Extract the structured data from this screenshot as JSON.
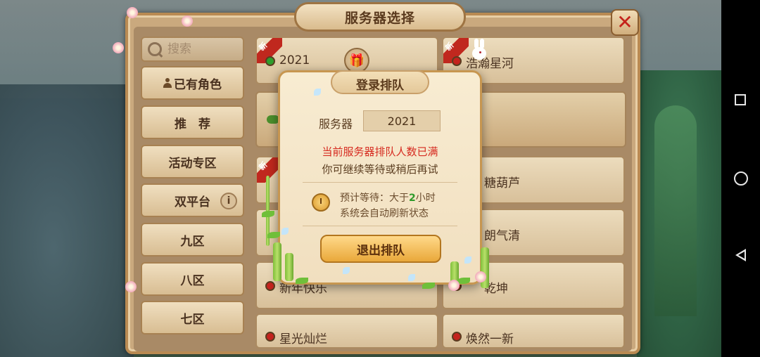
{
  "window": {
    "title": "服务器选择"
  },
  "sidebar": {
    "search_placeholder": "搜索",
    "items": [
      {
        "label": "已有角色",
        "icon": "user-icon"
      },
      {
        "label": "推　荐"
      },
      {
        "label": "活动专区"
      },
      {
        "label": "双平台",
        "icon": "info-icon",
        "icon_glyph": "i"
      },
      {
        "label": "九区"
      },
      {
        "label": "八区"
      },
      {
        "label": "七区"
      }
    ]
  },
  "server_list": {
    "new_tag": "新",
    "servers": [
      {
        "name": "2021",
        "status": "green",
        "new": true,
        "gift": true
      },
      {
        "name": "浩瀚星河",
        "status": "red",
        "new": true
      },
      {
        "name": "糖葫芦",
        "status": "red"
      },
      {
        "name": "朗气清",
        "status": "red"
      },
      {
        "name": "新年快乐",
        "status": "red"
      },
      {
        "name": "乾坤",
        "status": "red"
      },
      {
        "name": "星光灿烂",
        "status": "red"
      },
      {
        "name": "焕然一新",
        "status": "red"
      }
    ]
  },
  "queue_dialog": {
    "title": "登录排队",
    "server_label": "服务器",
    "server_value": "2021",
    "message_full": "当前服务器排队人数已满",
    "message_wait": "你可继续等待或稍后再试",
    "wait_prefix": "预计等待：大于",
    "wait_hours": "2",
    "wait_suffix": "小时",
    "auto_refresh": "系统会自动刷新状态",
    "exit_button": "退出排队"
  },
  "colors": {
    "online": "#2f9e2c",
    "busy": "#c4231e",
    "warning_text": "#d62a1f",
    "accent_button": "#e9a83a"
  }
}
